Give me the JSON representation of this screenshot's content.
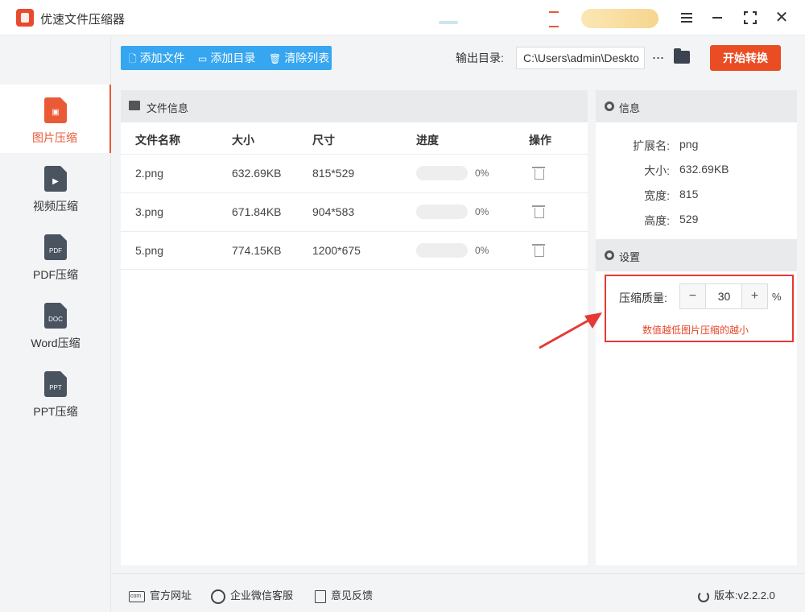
{
  "app": {
    "title": "优速文件压缩器"
  },
  "sidebar": {
    "items": [
      {
        "label": "图片压缩",
        "icon": "image-file-icon",
        "active": true,
        "badge": ""
      },
      {
        "label": "视频压缩",
        "icon": "video-file-icon",
        "active": false,
        "badge": "▶"
      },
      {
        "label": "PDF压缩",
        "icon": "pdf-file-icon",
        "active": false,
        "badge": "PDF"
      },
      {
        "label": "Word压缩",
        "icon": "word-file-icon",
        "active": false,
        "badge": "DOC"
      },
      {
        "label": "PPT压缩",
        "icon": "ppt-file-icon",
        "active": false,
        "badge": "PPT"
      }
    ]
  },
  "toolbar": {
    "add_file": "添加文件",
    "add_dir": "添加目录",
    "clear_list": "清除列表",
    "output_label": "输出目录:",
    "output_path": "C:\\Users\\admin\\Deskto",
    "more": "···",
    "start": "开始转换"
  },
  "file_panel": {
    "title": "文件信息",
    "columns": [
      "文件名称",
      "大小",
      "尺寸",
      "进度",
      "操作"
    ],
    "rows": [
      {
        "name": "2.png",
        "size": "632.69KB",
        "dims": "815*529",
        "progress": "0%"
      },
      {
        "name": "3.png",
        "size": "671.84KB",
        "dims": "904*583",
        "progress": "0%"
      },
      {
        "name": "5.png",
        "size": "774.15KB",
        "dims": "1200*675",
        "progress": "0%"
      }
    ]
  },
  "info_panel": {
    "title": "信息",
    "fields": [
      {
        "key": "扩展名:",
        "value": "png"
      },
      {
        "key": "大小:",
        "value": "632.69KB"
      },
      {
        "key": "宽度:",
        "value": "815"
      },
      {
        "key": "高度:",
        "value": "529"
      }
    ]
  },
  "settings": {
    "title": "设置",
    "quality_label": "压缩质量:",
    "quality_value": "30",
    "minus": "−",
    "plus": "+",
    "unit": "%",
    "hint": "数值越低图片压缩的越小"
  },
  "footer": {
    "website": "官方网址",
    "wechat": "企业微信客服",
    "feedback": "意见反馈",
    "version": "版本:v2.2.2.0"
  },
  "colors": {
    "accent": "#ea4d24",
    "toolbar_blue": "#36a6f0",
    "highlight_red": "#e53935"
  }
}
